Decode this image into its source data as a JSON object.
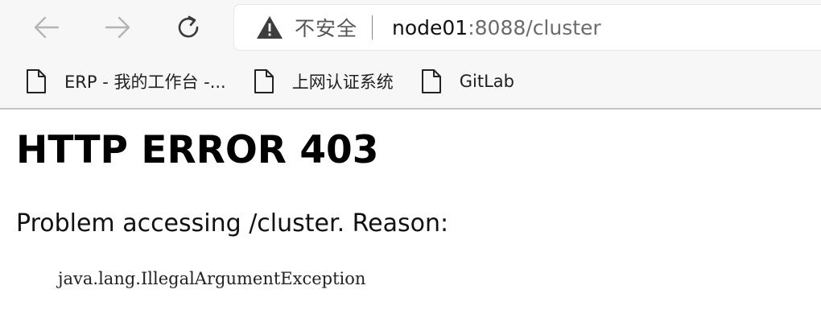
{
  "browser": {
    "nav": {
      "back_icon": "arrow-left-icon",
      "forward_icon": "arrow-right-icon",
      "refresh_icon": "refresh-icon"
    },
    "address_bar": {
      "security_icon": "warning-triangle-icon",
      "security_label": "不安全",
      "url_host": "node01",
      "url_rest": ":8088/cluster"
    },
    "bookmarks": [
      {
        "label": "ERP - 我的工作台 -...",
        "icon": "page-icon"
      },
      {
        "label": "上网认证系统",
        "icon": "page-icon"
      },
      {
        "label": "GitLab",
        "icon": "page-icon"
      }
    ]
  },
  "page": {
    "title": "HTTP ERROR 403",
    "problem": "Problem accessing /cluster. Reason:",
    "reason": "java.lang.IllegalArgumentException"
  },
  "colors": {
    "toolbar_bg": "#f7f7f7",
    "page_bg": "#ffffff",
    "nav_icon_disabled": "#b5b5b5",
    "nav_icon_active": "#3a3a3a"
  }
}
